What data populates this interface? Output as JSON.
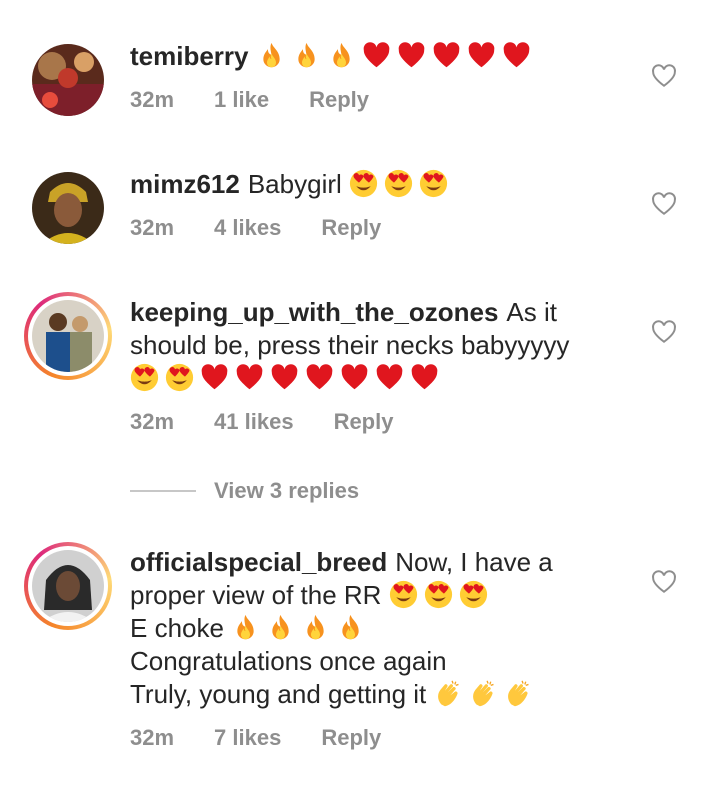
{
  "comments": [
    {
      "username": "temiberry",
      "message": "",
      "message_lines": [],
      "emoji": [
        "fire",
        "fire",
        "fire",
        "heart",
        "heart",
        "heart",
        "heart",
        "heart"
      ],
      "time": "32m",
      "likes": "1 like",
      "reply": "Reply"
    },
    {
      "username": "mimz612",
      "message": "Babygirl",
      "emoji": [
        "heart-eyes",
        "heart-eyes",
        "heart-eyes"
      ],
      "time": "32m",
      "likes": "4 likes",
      "reply": "Reply"
    },
    {
      "username": "keeping_up_with_the_ozones",
      "message": "As it",
      "line2": "should be, press their necks babyyyyy",
      "emoji": [
        "heart-eyes",
        "heart-eyes",
        "heart",
        "heart",
        "heart",
        "heart",
        "heart",
        "heart",
        "heart"
      ],
      "time": "32m",
      "likes": "41 likes",
      "reply": "Reply",
      "view_replies": "View 3 replies"
    },
    {
      "username": "officialspecial_breed",
      "message": "Now, I have a",
      "line2": "proper view of the RR",
      "line2_emoji": [
        "heart-eyes",
        "heart-eyes",
        "heart-eyes"
      ],
      "line3": "E choke",
      "line3_emoji": [
        "fire",
        "fire",
        "fire",
        "fire"
      ],
      "line4": "Congratulations once again",
      "line5": "Truly, young and getting it",
      "line5_emoji": [
        "clap",
        "clap",
        "clap"
      ],
      "time": "32m",
      "likes": "7 likes",
      "reply": "Reply"
    }
  ],
  "icons": {
    "like": "heart-outline-icon",
    "fire": "fire-emoji",
    "heart": "red-heart-emoji",
    "heart_eyes": "heart-eyes-emoji",
    "clap": "clapping-hands-emoji"
  },
  "colors": {
    "text": "#262626",
    "meta": "#8e8e8e",
    "heart": "#e0161e"
  }
}
